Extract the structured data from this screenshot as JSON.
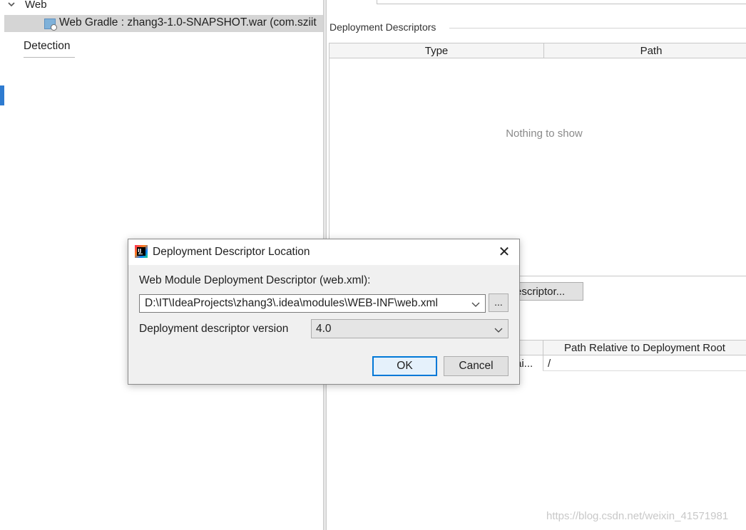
{
  "tree": {
    "web_label": "Web",
    "gradle_item_label": "Web Gradle : zhang3-1.0-SNAPSHOT.war (com.sziit",
    "detection_label": "Detection"
  },
  "deployment_descriptors": {
    "section_title": "Deployment Descriptors",
    "columns": [
      "Type",
      "Path"
    ],
    "empty_text": "Nothing to show",
    "add_button_label_visible": "escriptor..."
  },
  "resource_dirs": {
    "column_path_relative": "Path Relative to Deployment Root",
    "row_cell_truncated": "ai...",
    "row_path_relative": "/"
  },
  "dialog": {
    "title": "Deployment Descriptor Location",
    "close_glyph": "✕",
    "descriptor_label": "Web Module Deployment Descriptor (web.xml):",
    "descriptor_path": "D:\\IT\\IdeaProjects\\zhang3\\.idea\\modules\\WEB-INF\\web.xml",
    "browse_label": "...",
    "version_label": "Deployment descriptor version",
    "version_value": "4.0",
    "ok_label": "OK",
    "cancel_label": "Cancel"
  },
  "icons": {
    "tree_chevron": "chevron-down-icon",
    "facet": "web-facet-icon",
    "app": "intellij-idea-icon",
    "combo_arrow": "chevron-down-icon"
  },
  "colors": {
    "selection_bg": "#d5d5d5",
    "accent": "#0078d7",
    "left_accent": "#2e7bd0"
  },
  "watermark": "https://blog.csdn.net/weixin_41571981"
}
